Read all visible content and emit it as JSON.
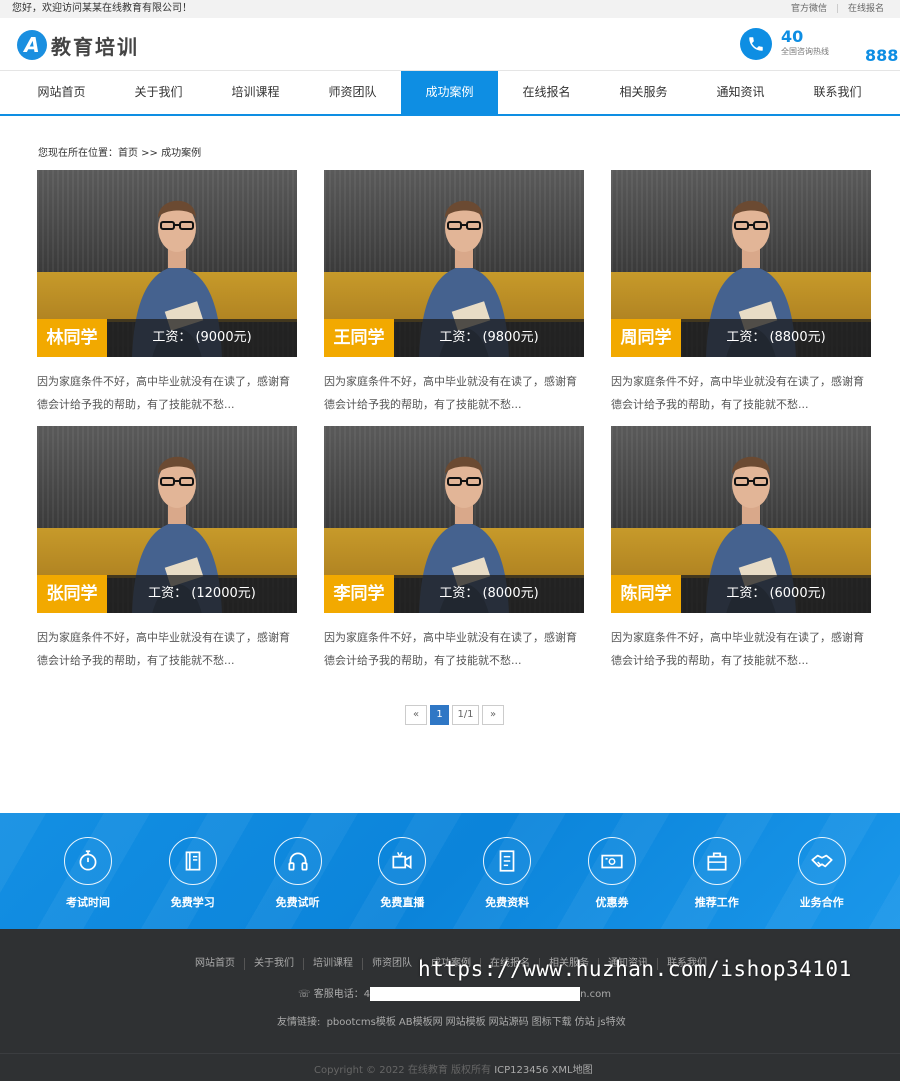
{
  "topbar": {
    "welcome": "您好，欢迎访问某某在线教育有限公司！",
    "links": [
      "官方微信",
      "在线报名"
    ]
  },
  "header": {
    "logo_mark": "A",
    "logo_text": "教育培训",
    "hotline_num": "40",
    "hotline_label": "全国咨询热线",
    "hotline_num2": "888"
  },
  "nav": [
    "网站首页",
    "关于我们",
    "培训课程",
    "师资团队",
    "成功案例",
    "在线报名",
    "相关服务",
    "通知资讯",
    "联系我们"
  ],
  "nav_active": 4,
  "breadcrumb": "您现在所在位置：首页 >> 成功案例",
  "cards": [
    {
      "name": "林同学",
      "salary": "工资：  (9000元)",
      "desc": "因为家庭条件不好，高中毕业就没有在读了，感谢育德会计给予我的帮助，有了技能就不愁..."
    },
    {
      "name": "王同学",
      "salary": "工资：  (9800元)",
      "desc": "因为家庭条件不好，高中毕业就没有在读了，感谢育德会计给予我的帮助，有了技能就不愁..."
    },
    {
      "name": "周同学",
      "salary": "工资：  (8800元)",
      "desc": "因为家庭条件不好，高中毕业就没有在读了，感谢育德会计给予我的帮助，有了技能就不愁..."
    },
    {
      "name": "张同学",
      "salary": "工资：  (12000元)",
      "desc": "因为家庭条件不好，高中毕业就没有在读了，感谢育德会计给予我的帮助，有了技能就不愁..."
    },
    {
      "name": "李同学",
      "salary": "工资：  (8000元)",
      "desc": "因为家庭条件不好，高中毕业就没有在读了，感谢育德会计给予我的帮助，有了技能就不愁..."
    },
    {
      "name": "陈同学",
      "salary": "工资：  (6000元)",
      "desc": "因为家庭条件不好，高中毕业就没有在读了，感谢育德会计给予我的帮助，有了技能就不愁..."
    }
  ],
  "pager": {
    "prev": "«",
    "current": "1",
    "total": "1/1",
    "next": "»"
  },
  "services": [
    {
      "label": "考试时间",
      "icon": "stopwatch-icon"
    },
    {
      "label": "免费学习",
      "icon": "book-icon"
    },
    {
      "label": "免费试听",
      "icon": "headphones-icon"
    },
    {
      "label": "免费直播",
      "icon": "video-icon"
    },
    {
      "label": "免费资料",
      "icon": "document-icon"
    },
    {
      "label": "优惠券",
      "icon": "coupon-icon"
    },
    {
      "label": "推荐工作",
      "icon": "briefcase-icon"
    },
    {
      "label": "业务合作",
      "icon": "handshake-icon"
    }
  ],
  "footer": {
    "nav": [
      "网站首页",
      "关于我们",
      "培训课程",
      "师资团队",
      "成功案例",
      "在线报名",
      "相关服务",
      "通知资讯",
      "联系我们"
    ],
    "phone_label": "客服电话：4",
    "phone_tail": "n.com",
    "links_label": "友情链接:",
    "links": [
      "pbootcms模板",
      "AB模板网",
      "网站模板",
      "网站源码",
      "图标下载",
      "仿站",
      "js特效"
    ],
    "copyright": "Copyright © 2022 在线教育 版权所有",
    "icp": "ICP123456",
    "sitemap": "XML地图"
  },
  "watermark": "https://www.huzhan.com/ishop34101",
  "colors": {
    "brand_blue": "#0e8ee3",
    "name_badge": "#f2a900",
    "footer_bg": "#2f3133",
    "pager_active": "#2f77c5"
  }
}
